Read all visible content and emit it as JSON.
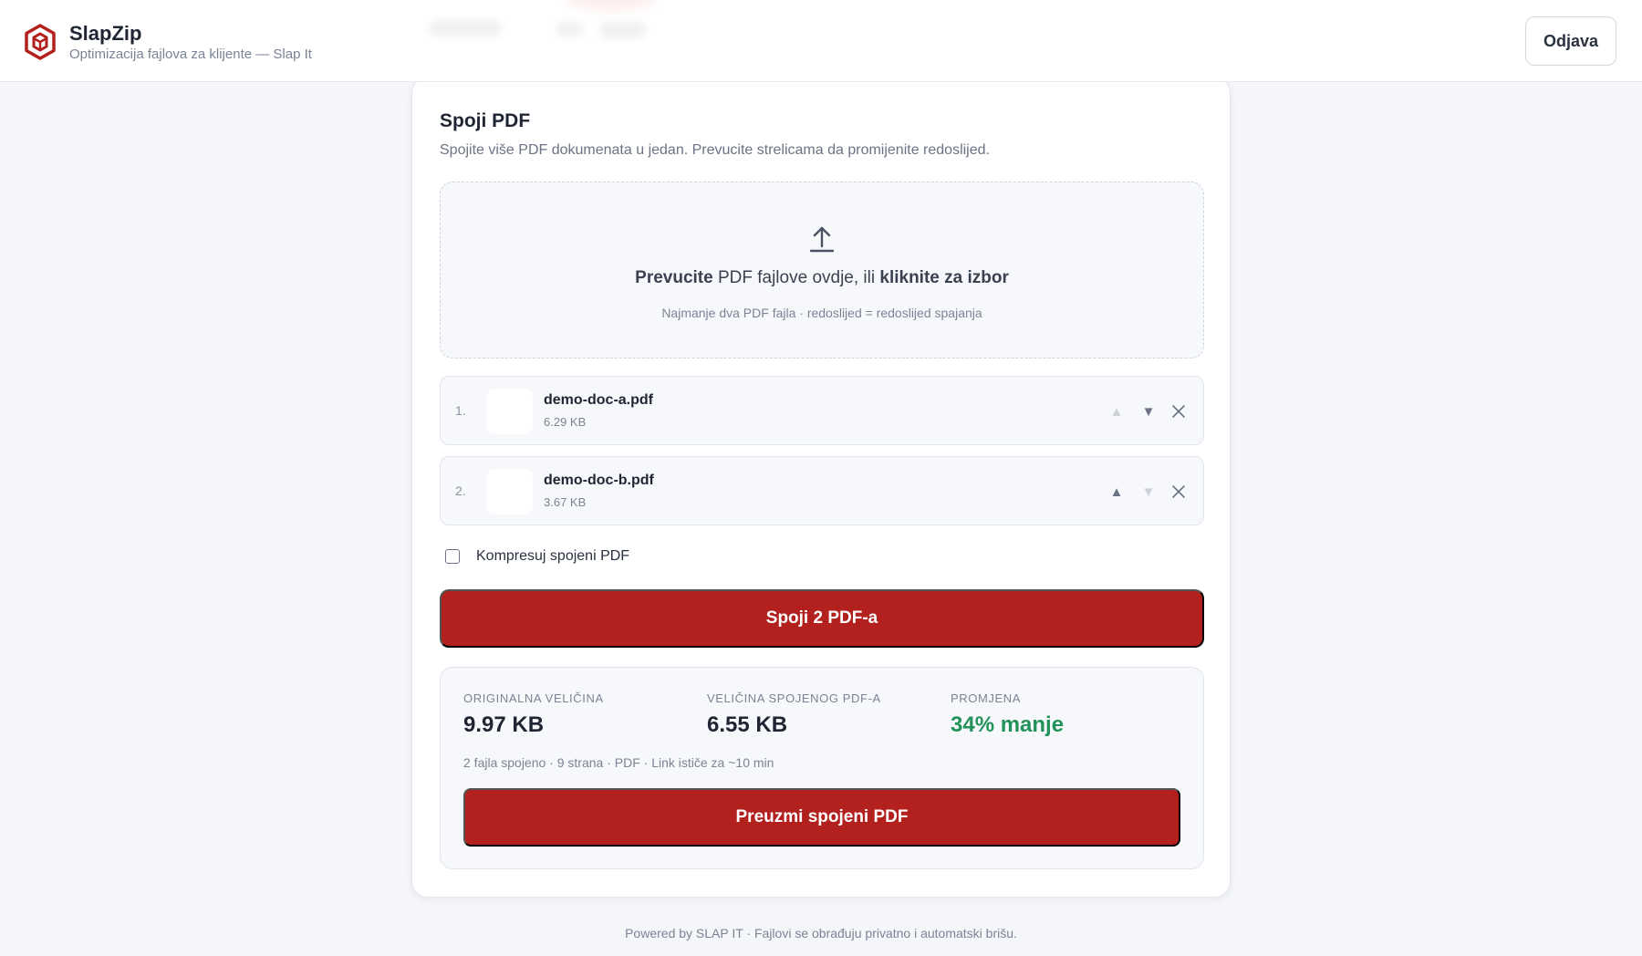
{
  "app": {
    "name": "SlapZip",
    "subtitle": "Optimizacija fajlova za klijente — Slap It",
    "logout_label": "Odjava"
  },
  "card": {
    "title": "Spoji PDF",
    "description": "Spojite više PDF dokumenata u jedan. Prevucite strelicama da promijenite redoslijed."
  },
  "dropzone": {
    "prefix_bold": "Prevucite",
    "middle": " PDF fajlove ovdje, ili ",
    "suffix_bold": "kliknite za izbor",
    "hint": "Najmanje dva PDF fajla · redoslijed = redoslijed spajanja",
    "icon": "upload-icon"
  },
  "files": [
    {
      "index": "1.",
      "name": "demo-doc-a.pdf",
      "size": "6.29 KB",
      "up_enabled": false,
      "down_enabled": true
    },
    {
      "index": "2.",
      "name": "demo-doc-b.pdf",
      "size": "3.67 KB",
      "up_enabled": true,
      "down_enabled": false
    }
  ],
  "compress_option": {
    "label": "Kompresuj spojeni PDF",
    "checked": false
  },
  "merge_button_label": "Spoji 2 PDF-a",
  "result": {
    "original": {
      "label": "Originalna veličina",
      "value": "9.97 KB"
    },
    "merged": {
      "label": "Veličina spojenog PDF-a",
      "value": "6.55 KB"
    },
    "change": {
      "label": "Promjena",
      "value": "34% manje"
    },
    "meta": "2 fajla spojeno · 9 strana · PDF · Link ističe za ~10 min",
    "download_label": "Preuzmi spojeni PDF"
  },
  "footer": "Powered by SLAP IT · Fajlovi se obrađuju privatno i automatski brišu.",
  "colors": {
    "accent": "#b3211e",
    "success": "#23925a"
  }
}
